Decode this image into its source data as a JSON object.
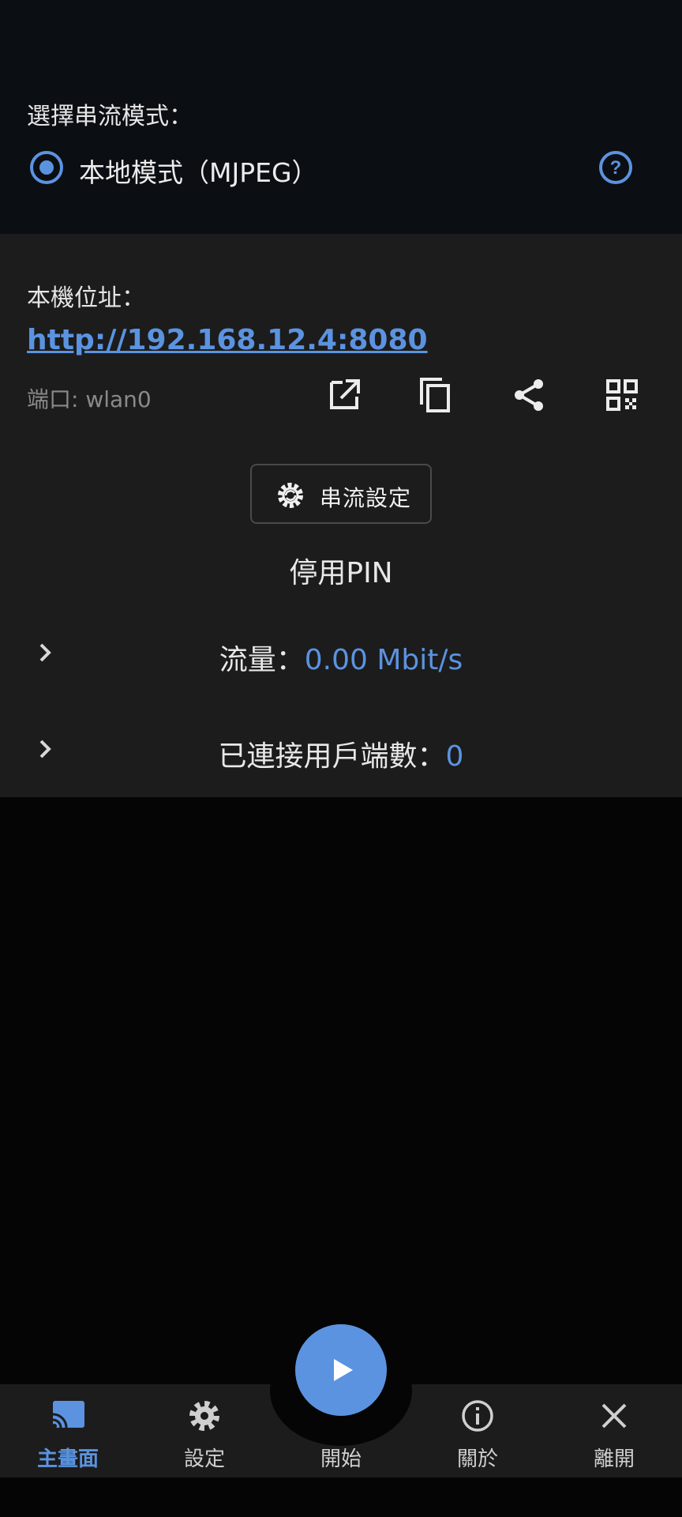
{
  "mode_section": {
    "label": "選擇串流模式：",
    "selected_mode": "本地模式（MJPEG）"
  },
  "address_section": {
    "label": "本機位址：",
    "url": "http://192.168.12.4:8080",
    "interface": "端口: wlan0"
  },
  "stream_settings_label": "串流設定",
  "pin_status": "停用PIN",
  "traffic": {
    "label": "流量：",
    "value": "0.00 Mbit/s"
  },
  "clients": {
    "label": "已連接用戶端數：",
    "value": "0"
  },
  "bottom_nav": {
    "home": "主畫面",
    "settings": "設定",
    "start": "開始",
    "about": "關於",
    "exit": "離開"
  },
  "colors": {
    "accent": "#5b93e0",
    "card": "#1c1c1c",
    "top": "#0b0e12"
  },
  "icons": [
    "help-icon",
    "open-external-icon",
    "copy-icon",
    "share-icon",
    "qr-code-icon",
    "settings-gear-icon",
    "chevron-right-icon",
    "cast-icon",
    "gear-icon",
    "play-icon",
    "info-icon",
    "close-icon"
  ]
}
